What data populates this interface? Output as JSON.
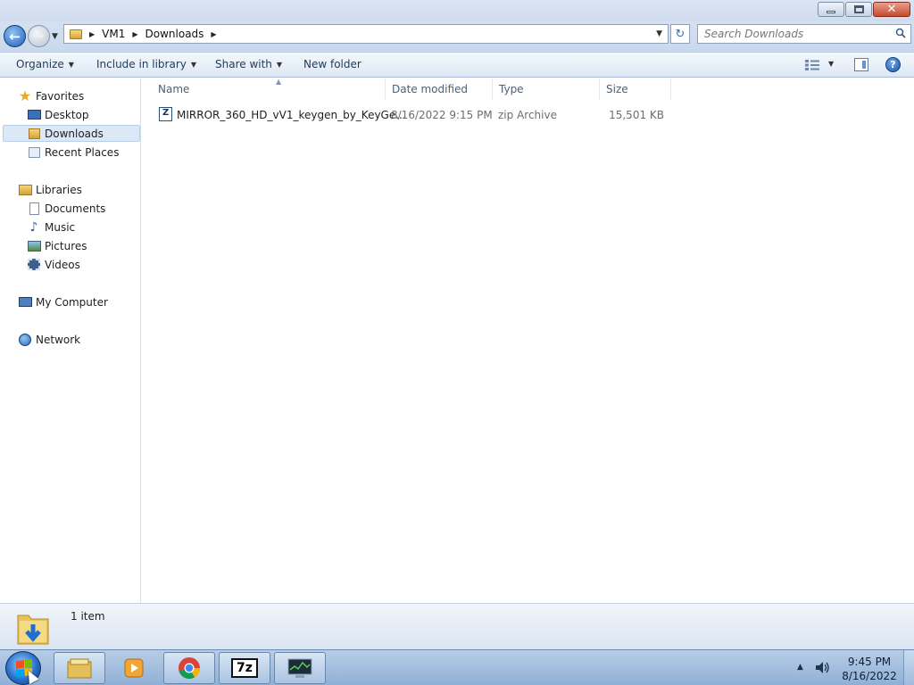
{
  "window": {
    "controls": {
      "minimize": "minimize",
      "maximize": "restore",
      "close": "close"
    }
  },
  "address": {
    "crumbs": [
      "VM1",
      "Downloads"
    ],
    "search_placeholder": "Search Downloads"
  },
  "toolbar": {
    "organize": "Organize",
    "include_in_library": "Include in library",
    "share_with": "Share with",
    "new_folder": "New folder"
  },
  "nav": {
    "favorites": {
      "label": "Favorites",
      "items": [
        {
          "label": "Desktop",
          "icon": "desktop-icon"
        },
        {
          "label": "Downloads",
          "icon": "downloads-folder-icon",
          "selected": true
        },
        {
          "label": "Recent Places",
          "icon": "recent-places-icon"
        }
      ]
    },
    "libraries": {
      "label": "Libraries",
      "items": [
        {
          "label": "Documents",
          "icon": "documents-icon"
        },
        {
          "label": "Music",
          "icon": "music-icon"
        },
        {
          "label": "Pictures",
          "icon": "pictures-icon"
        },
        {
          "label": "Videos",
          "icon": "videos-icon"
        }
      ]
    },
    "computer": "My Computer",
    "network": "Network"
  },
  "columns": [
    "Name",
    "Date modified",
    "Type",
    "Size"
  ],
  "files": [
    {
      "name": "MIRROR_360_HD_vV1_keygen_by_KeyGe...",
      "date_modified": "8/16/2022 9:15 PM",
      "type": "zip Archive",
      "size": "15,501 KB",
      "icon": "zip-archive-icon"
    }
  ],
  "status": {
    "item_count": "1 item"
  },
  "taskbar": {
    "apps": [
      "windows-explorer-icon",
      "media-player-icon",
      "chrome-icon",
      "7zip-icon",
      "task-manager-icon"
    ],
    "time": "9:45 PM",
    "date": "8/16/2022"
  },
  "colors": {
    "selected_bg": "#dce8f6",
    "header_text": "#4c607a",
    "taskbar": "#a9c3e2"
  }
}
